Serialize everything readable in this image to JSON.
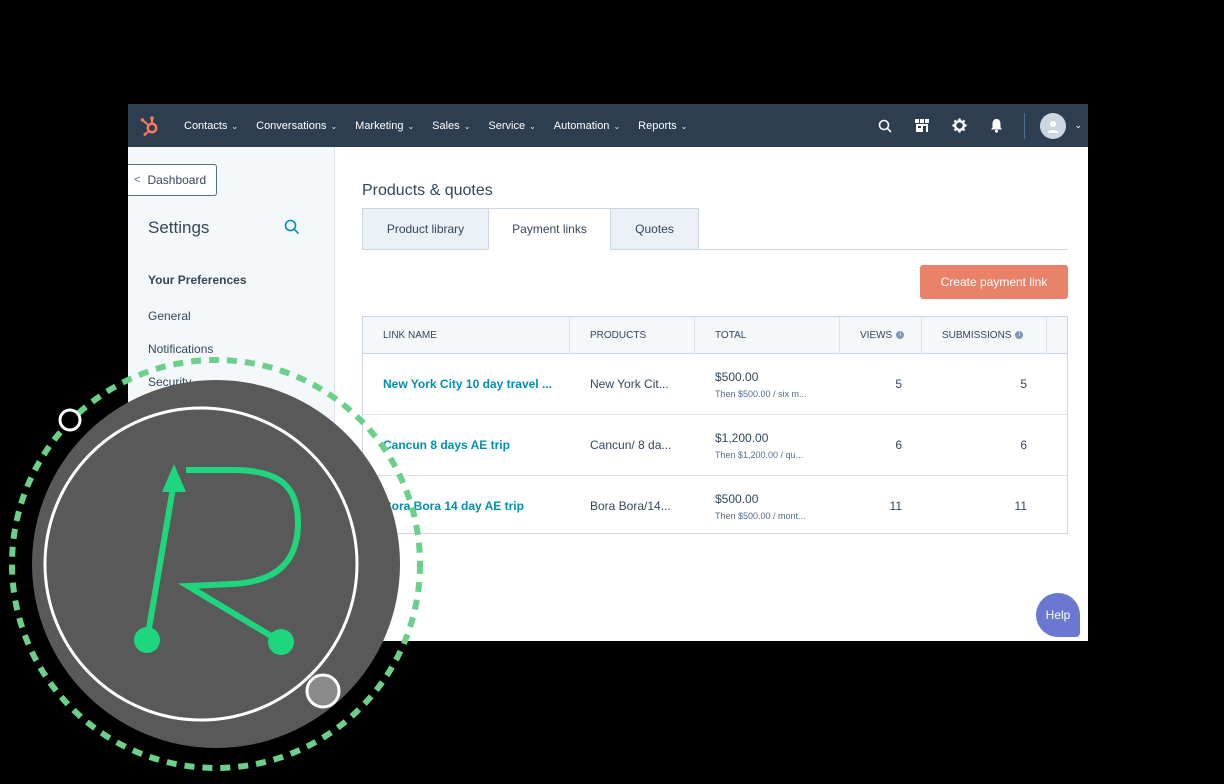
{
  "nav": {
    "items": [
      {
        "label": "Contacts"
      },
      {
        "label": "Conversations"
      },
      {
        "label": "Marketing"
      },
      {
        "label": "Sales"
      },
      {
        "label": "Service"
      },
      {
        "label": "Automation"
      },
      {
        "label": "Reports"
      }
    ],
    "icons": [
      "search-icon",
      "marketplace-icon",
      "gear-icon",
      "bell-icon"
    ],
    "brand_color": "#ff7a59",
    "bar_color": "#2d3e50"
  },
  "sidebar": {
    "back_label": "Dashboard",
    "title": "Settings",
    "section_heading": "Your Preferences",
    "links": [
      {
        "label": "General"
      },
      {
        "label": "Notifications"
      },
      {
        "label": "Security"
      }
    ]
  },
  "main": {
    "page_title": "Products & quotes",
    "tabs": [
      {
        "label": "Product library",
        "active": false
      },
      {
        "label": "Payment links",
        "active": true
      },
      {
        "label": "Quotes",
        "active": false
      }
    ],
    "create_button": "Create payment link",
    "table": {
      "columns": [
        "LINK NAME",
        "PRODUCTS",
        "TOTAL",
        "VIEWS",
        "SUBMISSIONS"
      ],
      "rows": [
        {
          "name": "New York City 10 day travel ...",
          "products": "New York Cit...",
          "total": "$500.00",
          "total_sub": "Then $500.00 / six m...",
          "views": "5",
          "submissions": "5"
        },
        {
          "name": "Cancun 8 days AE trip",
          "products": "Cancun/ 8 da...",
          "total": "$1,200.00",
          "total_sub": "Then $1,200.00 / qu...",
          "views": "6",
          "submissions": "6"
        },
        {
          "name": "Bora Bora 14 day AE trip",
          "products": "Bora Bora/14...",
          "total": "$500.00",
          "total_sub": "Then $500.00 / mont...",
          "views": "11",
          "submissions": "11"
        }
      ]
    },
    "help_label": "Help"
  },
  "overlay": {
    "logo_icon": "r-logo-icon",
    "accent_color": "#1ed67e",
    "ring_color": "#6bd18a"
  }
}
